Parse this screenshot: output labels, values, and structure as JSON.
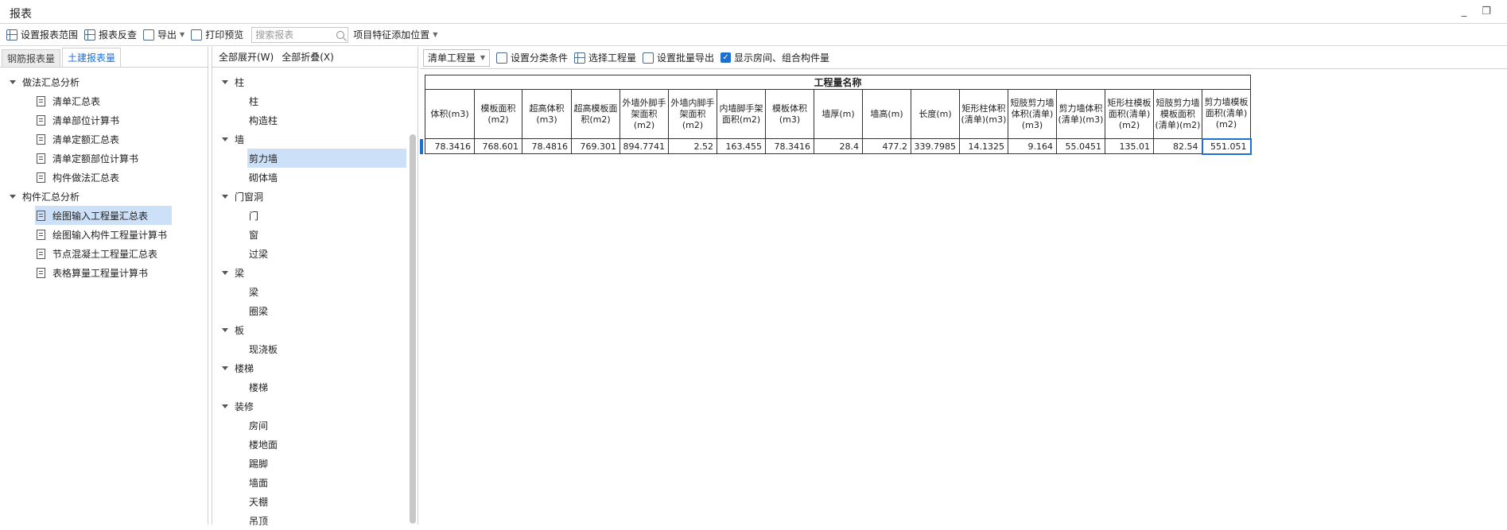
{
  "window": {
    "title": "报表",
    "minimize": "_",
    "restore": "❐"
  },
  "toolbar": {
    "set_range": "设置报表范围",
    "reverse_check": "报表反查",
    "export": "导出",
    "print_preview": "打印预览",
    "search_placeholder": "搜索报表",
    "add_feature_position": "项目特征添加位置"
  },
  "left_panel": {
    "tabs": [
      "钢筋报表量",
      "土建报表量"
    ],
    "groups": [
      {
        "label": "做法汇总分析",
        "items": [
          "清单汇总表",
          "清单部位计算书",
          "清单定额汇总表",
          "清单定额部位计算书",
          "构件做法汇总表"
        ]
      },
      {
        "label": "构件汇总分析",
        "items": [
          "绘图输入工程量汇总表",
          "绘图输入构件工程量计算书",
          "节点混凝土工程量汇总表",
          "表格算量工程量计算书"
        ]
      }
    ]
  },
  "middle_panel": {
    "expand_all": "全部展开(W)",
    "collapse_all": "全部折叠(X)",
    "categories": [
      {
        "label": "柱",
        "items": [
          "柱",
          "构造柱"
        ]
      },
      {
        "label": "墙",
        "items": [
          "剪力墙",
          "砌体墙"
        ]
      },
      {
        "label": "门窗洞",
        "items": [
          "门",
          "窗",
          "过梁"
        ]
      },
      {
        "label": "梁",
        "items": [
          "梁",
          "圈梁"
        ]
      },
      {
        "label": "板",
        "items": [
          "现浇板"
        ]
      },
      {
        "label": "楼梯",
        "items": [
          "楼梯"
        ]
      },
      {
        "label": "装修",
        "items": [
          "房间",
          "楼地面",
          "踢脚",
          "墙面",
          "天棚",
          "吊顶"
        ]
      }
    ]
  },
  "right_toolbar": {
    "quantity_type": "清单工程量",
    "set_category": "设置分类条件",
    "select_quantity": "选择工程量",
    "batch_export": "设置批量导出",
    "show_rooms": "显示房间、组合构件量"
  },
  "table": {
    "caption": "工程量名称",
    "columns": [
      "体积(m3)",
      "模板面积(m2)",
      "超高体积(m3)",
      "超高模板面积(m2)",
      "外墙外脚手架面积(m2)",
      "外墙内脚手架面积(m2)",
      "内墙脚手架面积(m2)",
      "模板体积(m3)",
      "墙厚(m)",
      "墙高(m)",
      "长度(m)",
      "矩形柱体积(清单)(m3)",
      "短肢剪力墙体积(清单)(m3)",
      "剪力墙体积(清单)(m3)",
      "矩形柱模板面积(清单)(m2)",
      "短肢剪力墙模板面积(清单)(m2)",
      "剪力墙模板面积(清单)(m2)"
    ],
    "values": [
      "78.3416",
      "768.601",
      "78.4816",
      "769.301",
      "894.7741",
      "2.52",
      "163.455",
      "78.3416",
      "28.4",
      "477.2",
      "339.7985",
      "14.1325",
      "9.164",
      "55.0451",
      "135.01",
      "82.54",
      "551.051"
    ]
  }
}
